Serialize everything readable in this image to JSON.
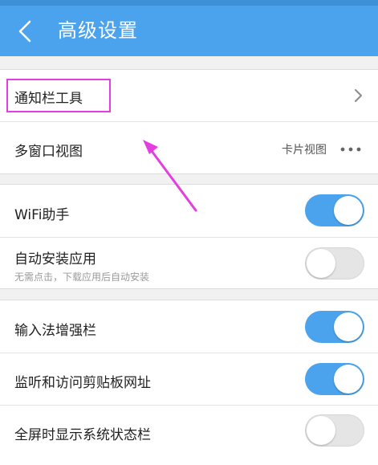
{
  "header": {
    "title": "高级设置",
    "back_icon": "chevron-left-icon"
  },
  "colors": {
    "header_bg": "#4aa3ec",
    "status_strip": "#3d8fd6",
    "toggle_on": "#4aa3ec",
    "toggle_off": "#e5e5e5",
    "highlight": "#e53ee0",
    "page_bg": "#f1f1f1"
  },
  "groups": [
    {
      "rows": [
        {
          "label": "通知栏工具",
          "accessory": "chevron-right-icon"
        },
        {
          "label": "多窗口视图",
          "value": "卡片视图",
          "accessory": "more-horizontal-icon"
        }
      ]
    },
    {
      "rows": [
        {
          "label": "WiFi助手",
          "toggle": "on"
        },
        {
          "label": "自动安装应用",
          "sublabel": "无需点击，下载应用后自动安装",
          "toggle": "off"
        }
      ]
    },
    {
      "rows": [
        {
          "label": "输入法增强栏",
          "toggle": "on"
        },
        {
          "label": "监听和访问剪贴板网址",
          "toggle": "on"
        },
        {
          "label": "全屏时显示系统状态栏",
          "toggle": "off"
        }
      ]
    }
  ],
  "annotation": {
    "highlight_target": "通知栏工具",
    "arrow_color": "#e53ee0"
  }
}
